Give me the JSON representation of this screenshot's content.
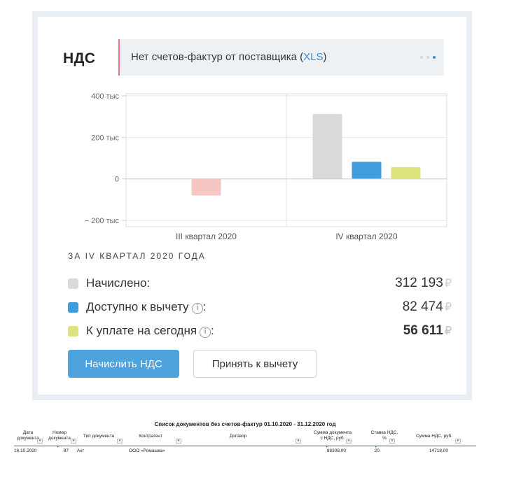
{
  "card": {
    "title": "НДС",
    "message_prefix": "Нет счетов-фактур от поставщика (",
    "message_link": "XLS",
    "message_suffix": ")",
    "period_label": "ЗА IV КВАРТАЛ 2020 ГОДА",
    "legend": [
      {
        "label": "Начислено:",
        "amount": "312 193",
        "color": "#d9d9d9",
        "info": false,
        "bold": false
      },
      {
        "label": "Доступно к вычету",
        "suffix": ":",
        "amount": "82 474",
        "color": "#3f9ddd",
        "info": true,
        "bold": false
      },
      {
        "label": "К уплате на сегодня",
        "suffix": ":",
        "amount": "56 611",
        "color": "#dbe37a",
        "info": true,
        "bold": true
      }
    ],
    "currency": "₽",
    "info_glyph": "i",
    "buttons": {
      "primary": "Начислить НДС",
      "secondary": "Принять к вычету"
    },
    "dots": {
      "count": 3,
      "active_index": 2
    }
  },
  "chart_data": {
    "type": "bar",
    "categories": [
      "III квартал 2020",
      "IV квартал 2020"
    ],
    "series": [
      {
        "name": "Начислено",
        "color": "#d9d9d9",
        "values": [
          null,
          312193
        ]
      },
      {
        "name": "Доступно к вычету",
        "color": "#3f9ddd",
        "values": [
          null,
          82474
        ]
      },
      {
        "name": "К уплате на сегодня",
        "color": "#dbe37a",
        "values": [
          -80000,
          56611
        ]
      }
    ],
    "negative_color": "#f5c6c2",
    "yticks": [
      400000,
      200000,
      0,
      -200000
    ],
    "yticklabels": [
      "400 тыс",
      "200 тыс",
      "0",
      "− 200 тыс"
    ],
    "ylim": [
      -230000,
      410000
    ],
    "grid": true
  },
  "sheet": {
    "title": "Список документов без счетов-фактур 01.10.2020 - 31.12.2020 год",
    "headers": [
      "Дата\nдокумента",
      "Номер\nдокумента",
      "Тип документа",
      "Контрагент",
      "Договор",
      "Сумма документа\nс НДС, руб.",
      "Ставка НДС,\n%",
      "Сумма НДС, руб."
    ],
    "filter_glyph": "▾",
    "rows": [
      [
        "16.10.2020",
        "87",
        "Акт",
        "ООО «Ромашка»",
        "",
        "88308,00",
        "20",
        "14718,00"
      ]
    ]
  }
}
